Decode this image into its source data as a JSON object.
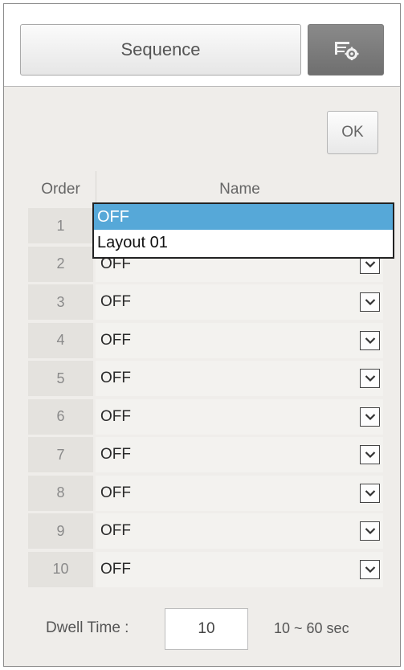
{
  "toolbar": {
    "sequence_label": "Sequence",
    "settings_icon": "layout-settings-icon"
  },
  "ok_label": "OK",
  "table": {
    "headers": {
      "order": "Order",
      "name": "Name"
    },
    "rows": [
      {
        "order": "1",
        "name": "OFF"
      },
      {
        "order": "2",
        "name": "OFF"
      },
      {
        "order": "3",
        "name": "OFF"
      },
      {
        "order": "4",
        "name": "OFF"
      },
      {
        "order": "5",
        "name": "OFF"
      },
      {
        "order": "6",
        "name": "OFF"
      },
      {
        "order": "7",
        "name": "OFF"
      },
      {
        "order": "8",
        "name": "OFF"
      },
      {
        "order": "9",
        "name": "OFF"
      },
      {
        "order": "10",
        "name": "OFF"
      }
    ]
  },
  "dropdown": {
    "open_row": "1",
    "options": [
      "OFF",
      "Layout 01"
    ],
    "selected": "OFF"
  },
  "dwell": {
    "label": "Dwell Time :",
    "value": "10",
    "range": "10 ~ 60 sec"
  },
  "colors": {
    "highlight": "#56a8d8",
    "settings_button": "#7a7a7a"
  }
}
